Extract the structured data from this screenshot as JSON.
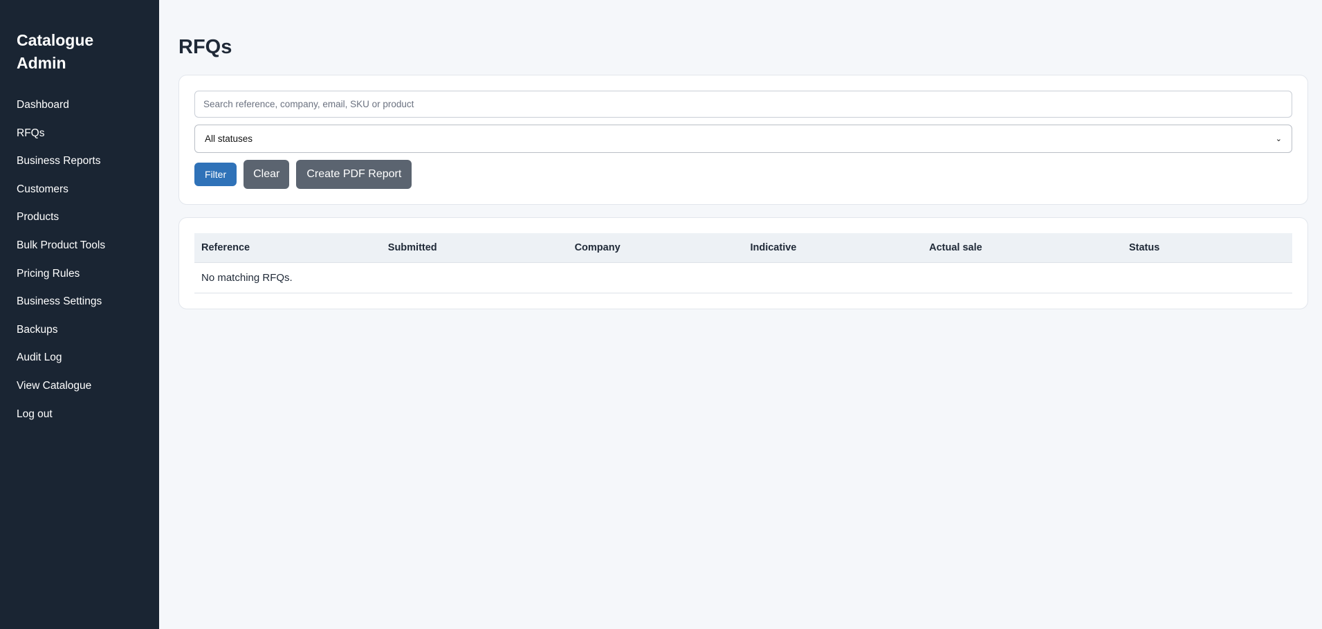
{
  "sidebar": {
    "brand": "Catalogue Admin",
    "items": [
      {
        "label": "Dashboard"
      },
      {
        "label": "RFQs"
      },
      {
        "label": "Business Reports"
      },
      {
        "label": "Customers"
      },
      {
        "label": "Products"
      },
      {
        "label": "Bulk Product Tools"
      },
      {
        "label": "Pricing Rules"
      },
      {
        "label": "Business Settings"
      },
      {
        "label": "Backups"
      },
      {
        "label": "Audit Log"
      },
      {
        "label": "View Catalogue"
      },
      {
        "label": "Log out"
      }
    ]
  },
  "main": {
    "title": "RFQs",
    "search": {
      "placeholder": "Search reference, company, email, SKU or product",
      "value": ""
    },
    "status_select": {
      "selected": "All statuses"
    },
    "buttons": {
      "filter": "Filter",
      "clear": "Clear",
      "pdf": "Create PDF Report"
    },
    "table": {
      "columns": [
        "Reference",
        "Submitted",
        "Company",
        "Indicative",
        "Actual sale",
        "Status"
      ],
      "empty_message": "No matching RFQs."
    }
  },
  "colors": {
    "sidebar_bg": "#1a2533",
    "page_bg": "#f5f7fa",
    "primary": "#2f72b8",
    "secondary": "#5b6470"
  }
}
